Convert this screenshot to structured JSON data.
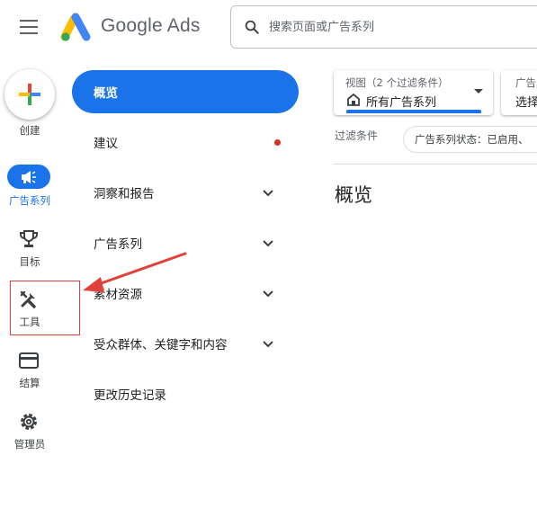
{
  "header": {
    "brand": "Google Ads",
    "search_placeholder": "搜索页面或广告系列"
  },
  "rail": {
    "create": "创建",
    "campaigns": "广告系列",
    "goals": "目标",
    "tools": "工具",
    "billing": "结算",
    "admin": "管理员"
  },
  "nav": {
    "overview": "概览",
    "recommendations": "建议",
    "insights": "洞察和报告",
    "campaigns": "广告系列",
    "assets": "素材资源",
    "audiences": "受众群体、关键字和内容",
    "change_history": "更改历史记录"
  },
  "main": {
    "view_caption": "视图（2 个过滤条件）",
    "view_value": "所有广告系列",
    "campaign_caption": "广告",
    "campaign_value": "选择",
    "filters_label": "过滤条件",
    "filter_chip": "广告系列状态：已启用、",
    "page_title": "概览"
  },
  "colors": {
    "accent": "#1a73e8",
    "dot": "#d93025",
    "annotation": "#e0413a"
  }
}
